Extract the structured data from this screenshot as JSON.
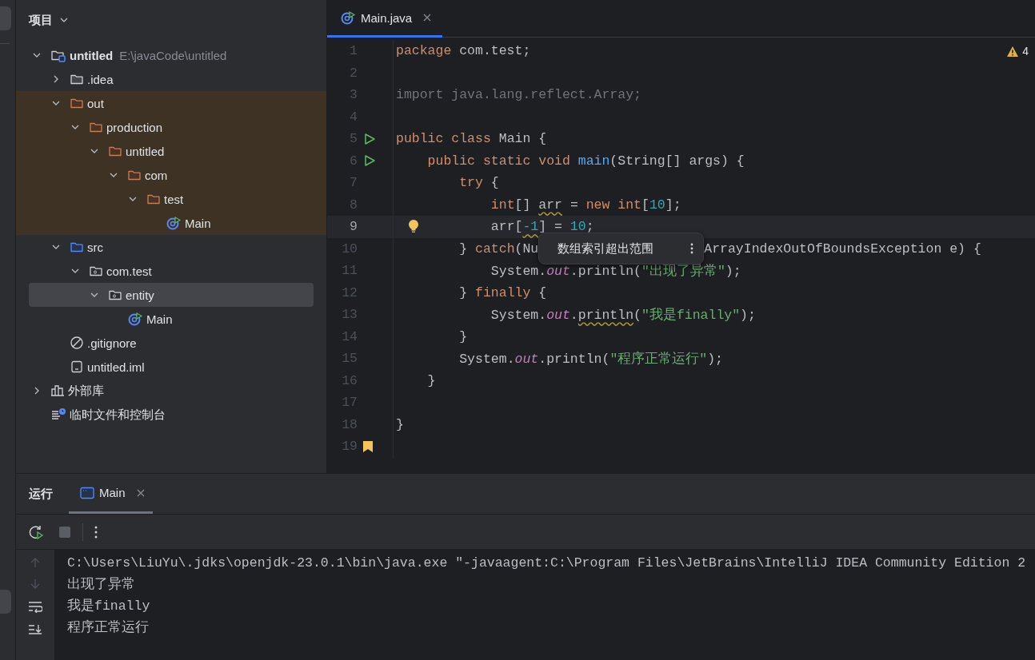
{
  "project_panel": {
    "title": "项目",
    "tree": [
      {
        "label": "untitled",
        "kind": "module",
        "path": "E:\\javaCode\\untitled",
        "expanded": true,
        "selected": false,
        "excluded": false,
        "children": [
          {
            "label": ".idea",
            "kind": "folder",
            "expanded": false,
            "selected": false,
            "excluded": false
          },
          {
            "label": "out",
            "kind": "folder-excluded",
            "expanded": true,
            "selected": false,
            "excluded": true,
            "children": [
              {
                "label": "production",
                "kind": "folder-excluded",
                "expanded": true,
                "selected": false,
                "excluded": true,
                "children": [
                  {
                    "label": "untitled",
                    "kind": "folder-excluded",
                    "expanded": true,
                    "selected": false,
                    "excluded": true,
                    "children": [
                      {
                        "label": "com",
                        "kind": "folder-excluded",
                        "expanded": true,
                        "selected": false,
                        "excluded": true,
                        "children": [
                          {
                            "label": "test",
                            "kind": "folder-excluded",
                            "expanded": true,
                            "selected": false,
                            "excluded": true,
                            "children": [
                              {
                                "label": "Main",
                                "kind": "class",
                                "selected": false,
                                "excluded": true
                              }
                            ]
                          }
                        ]
                      }
                    ]
                  }
                ]
              }
            ]
          },
          {
            "label": "src",
            "kind": "folder-source",
            "expanded": true,
            "selected": false,
            "excluded": false,
            "children": [
              {
                "label": "com.test",
                "kind": "package",
                "expanded": true,
                "selected": false,
                "excluded": false,
                "children": [
                  {
                    "label": "entity",
                    "kind": "package",
                    "expanded": true,
                    "selected": true,
                    "excluded": false,
                    "children": [
                      {
                        "label": "Main",
                        "kind": "class",
                        "selected": false,
                        "excluded": false
                      }
                    ]
                  }
                ]
              }
            ]
          },
          {
            "label": ".gitignore",
            "kind": "gitignore",
            "selected": false,
            "excluded": false
          },
          {
            "label": "untitled.iml",
            "kind": "iml",
            "selected": false,
            "excluded": false
          }
        ]
      },
      {
        "label": "外部库",
        "kind": "library",
        "expanded": false,
        "selected": false,
        "excluded": false
      },
      {
        "label": "临时文件和控制台",
        "kind": "scratch",
        "selected": false,
        "excluded": false
      }
    ]
  },
  "editor": {
    "tabs": [
      {
        "label": "Main.java",
        "selected": true
      }
    ],
    "warning_count": "4",
    "lines": [
      {
        "number": "1",
        "current": false,
        "kind": "plain",
        "tokens": [
          {
            "kind": "kw",
            "text": "package"
          },
          {
            "kind": "id",
            "text": " com.test;"
          }
        ]
      },
      {
        "number": "2",
        "current": false,
        "kind": "plain"
      },
      {
        "number": "3",
        "current": false,
        "kind": "plain",
        "tokens": [
          {
            "kind": "dim",
            "text": "import java.lang.reflect.Array;"
          }
        ]
      },
      {
        "number": "4",
        "current": false,
        "kind": "plain"
      },
      {
        "number": "5",
        "current": false,
        "kind": "run",
        "tokens": [
          {
            "kind": "kw",
            "text": "public class"
          },
          {
            "kind": "id",
            "text": " Main {"
          }
        ]
      },
      {
        "number": "6",
        "current": false,
        "kind": "run",
        "tokens": [
          {
            "kind": "kw",
            "text": "    public static void"
          },
          {
            "kind": "fn",
            "text": " main"
          },
          {
            "kind": "id",
            "text": "(String[] args) {"
          }
        ]
      },
      {
        "number": "7",
        "current": false,
        "kind": "plain",
        "tokens": [
          {
            "kind": "kw",
            "text": "        try"
          },
          {
            "kind": "id",
            "text": " {"
          }
        ]
      },
      {
        "number": "8",
        "current": false,
        "kind": "plain",
        "tokens": [
          {
            "kind": "kw",
            "text": "            int"
          },
          {
            "kind": "id",
            "text": "[] "
          },
          {
            "kind": "warn-id",
            "text": "arr"
          },
          {
            "kind": "id",
            "text": " = "
          },
          {
            "kind": "kw",
            "text": "new int"
          },
          {
            "kind": "id",
            "text": "["
          },
          {
            "kind": "num",
            "text": "10"
          },
          {
            "kind": "id",
            "text": "];"
          }
        ]
      },
      {
        "number": "9",
        "current": true,
        "kind": "bulb",
        "tokens": [
          {
            "kind": "id",
            "text": "            arr["
          },
          {
            "kind": "warn-num",
            "text": "-1"
          },
          {
            "kind": "id",
            "text": "] = "
          },
          {
            "kind": "num",
            "text": "10"
          },
          {
            "kind": "id",
            "text": ";"
          }
        ]
      },
      {
        "number": "10",
        "current": false,
        "kind": "plain",
        "tokens": [
          {
            "kind": "id",
            "text": "        } "
          },
          {
            "kind": "kw",
            "text": "catch"
          },
          {
            "kind": "id",
            "text": "(Nu"
          },
          {
            "kind": "popup",
            "text": "数组索引超出范围"
          },
          {
            "kind": "id",
            "text": "ArrayIndexOutOfBoundsException e) {"
          }
        ]
      },
      {
        "number": "11",
        "current": false,
        "kind": "plain",
        "tokens": [
          {
            "kind": "id",
            "text": "            System."
          },
          {
            "kind": "field",
            "text": "out"
          },
          {
            "kind": "id",
            "text": ".println("
          },
          {
            "kind": "str",
            "text": "\"出现了异常\""
          },
          {
            "kind": "id",
            "text": ");"
          }
        ]
      },
      {
        "number": "12",
        "current": false,
        "kind": "plain",
        "tokens": [
          {
            "kind": "id",
            "text": "        } "
          },
          {
            "kind": "kw",
            "text": "finally"
          },
          {
            "kind": "id",
            "text": " {"
          }
        ]
      },
      {
        "number": "13",
        "current": false,
        "kind": "plain",
        "tokens": [
          {
            "kind": "id",
            "text": "            System."
          },
          {
            "kind": "field",
            "text": "out"
          },
          {
            "kind": "id",
            "text": "."
          },
          {
            "kind": "warn-id",
            "text": "println"
          },
          {
            "kind": "id",
            "text": "("
          },
          {
            "kind": "str",
            "text": "\"我是finally\""
          },
          {
            "kind": "id",
            "text": ");"
          }
        ]
      },
      {
        "number": "14",
        "current": false,
        "kind": "plain",
        "tokens": [
          {
            "kind": "id",
            "text": "        }"
          }
        ]
      },
      {
        "number": "15",
        "current": false,
        "kind": "plain",
        "tokens": [
          {
            "kind": "id",
            "text": "        System."
          },
          {
            "kind": "field",
            "text": "out"
          },
          {
            "kind": "id",
            "text": ".println("
          },
          {
            "kind": "str",
            "text": "\"程序正常运行\""
          },
          {
            "kind": "id",
            "text": ");"
          }
        ]
      },
      {
        "number": "16",
        "current": false,
        "kind": "plain",
        "tokens": [
          {
            "kind": "id",
            "text": "    }"
          }
        ]
      },
      {
        "number": "17",
        "current": false,
        "kind": "plain"
      },
      {
        "number": "18",
        "current": false,
        "kind": "plain",
        "tokens": [
          {
            "kind": "id",
            "text": "}"
          }
        ]
      },
      {
        "number": "19",
        "current": false,
        "kind": "bookmark"
      }
    ]
  },
  "run_panel": {
    "title": "运行",
    "tabs": [
      {
        "label": "Main",
        "selected": true
      }
    ],
    "toolbar": [
      {
        "kind": "rerun",
        "disabled": false
      },
      {
        "kind": "stop",
        "disabled": true
      },
      {
        "kind": "more",
        "disabled": false
      }
    ],
    "output": [
      "C:\\Users\\LiuYu\\.jdks\\openjdk-23.0.1\\bin\\java.exe \"-javaagent:C:\\Program Files\\JetBrains\\IntelliJ IDEA Community Edition 2",
      "出现了异常",
      "我是finally",
      "程序正常运行"
    ]
  }
}
